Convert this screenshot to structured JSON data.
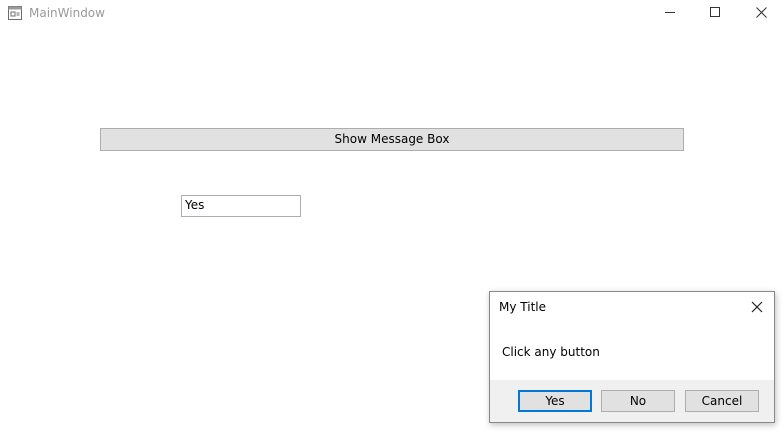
{
  "window": {
    "title": "MainWindow",
    "icon": "window-app-icon",
    "controls": [
      "minimize-icon",
      "maximize-icon",
      "close-icon"
    ]
  },
  "main": {
    "show_button_label": "Show Message Box",
    "result_value": "Yes"
  },
  "dialog": {
    "title": "My Title",
    "message": "Click any button",
    "buttons": {
      "yes": "Yes",
      "no": "No",
      "cancel": "Cancel"
    },
    "focus_color": "#0078d7"
  }
}
